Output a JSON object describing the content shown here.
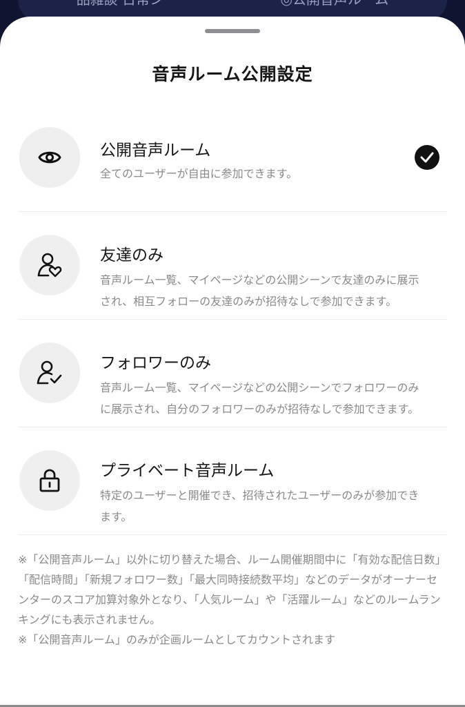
{
  "background": {
    "tabs": [
      "品雑談·日常シ",
      "◎公開音声ルーム"
    ]
  },
  "sheet": {
    "title": "音声ルーム公開設定",
    "selected_index": 0,
    "options": [
      {
        "title": "公開音声ルーム",
        "desc": "全てのユーザーが自由に参加できます。",
        "icon": "eye-icon",
        "selected": true
      },
      {
        "title": "友達のみ",
        "desc": "音声ルーム一覧、マイページなどの公開シーンで友達のみに展示され、相互フォローの友達のみが招待なしで参加できます。",
        "icon": "user-heart-icon",
        "selected": false
      },
      {
        "title": "フォロワーのみ",
        "desc": "音声ルーム一覧、マイページなどの公開シーンでフォロワーのみに展示され、自分のフォロワーのみが招待なしで参加できます。",
        "icon": "user-check-icon",
        "selected": false
      },
      {
        "title": "プライベート音声ルーム",
        "desc": "特定のユーザーと開催でき、招待されたユーザーのみが参加できます。",
        "icon": "lock-icon",
        "selected": false
      }
    ],
    "notes": [
      "※「公開音声ルーム」以外に切り替えた場合、ルーム開催期間中に「有効な配信日数」「配信時間」「新規フォロワー数」「最大同時接続数平均」などのデータがオーナーセンターのスコア加算対象外となり、「人気ルーム」や「活躍ルーム」などのルームランキングにも表示されません。",
      "※「公開音声ルーム」のみが企画ルームとしてカウントされます"
    ]
  },
  "colors": {
    "background": "#0f1530",
    "sheet": "#ffffff",
    "check": "#111111",
    "secondary_text": "#8a8a8a"
  }
}
